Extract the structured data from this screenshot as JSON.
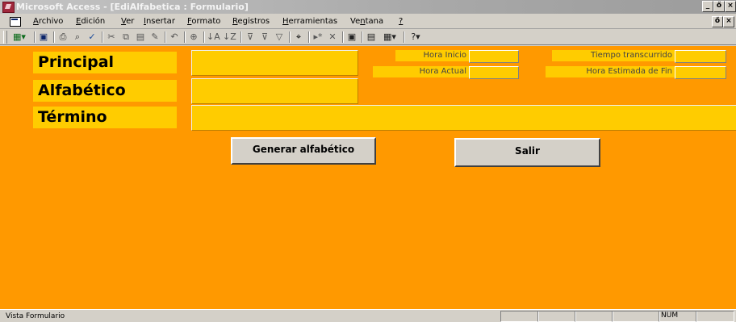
{
  "window": {
    "title": "Microsoft Access - [EdiAlfabetica : Formulario]",
    "controls": [
      "_",
      "ő",
      "×"
    ]
  },
  "menu": [
    {
      "key": "archivo",
      "prefix": "",
      "u": "A",
      "rest": "rchivo"
    },
    {
      "key": "edicion",
      "prefix": "",
      "u": "E",
      "rest": "dición"
    },
    {
      "key": "ver",
      "prefix": "",
      "u": "V",
      "rest": "er"
    },
    {
      "key": "insertar",
      "prefix": "",
      "u": "I",
      "rest": "nsertar"
    },
    {
      "key": "formato",
      "prefix": "",
      "u": "F",
      "rest": "ormato"
    },
    {
      "key": "registros",
      "prefix": "",
      "u": "R",
      "rest": "egistros"
    },
    {
      "key": "herramientas",
      "prefix": "",
      "u": "H",
      "rest": "erramientas"
    },
    {
      "key": "ventana",
      "prefix": "Ve",
      "u": "n",
      "rest": "tana"
    },
    {
      "key": "ayuda",
      "prefix": "",
      "u": "?",
      "rest": ""
    }
  ],
  "toolbar_icons": [
    "view-icon",
    "save-icon",
    "print-icon",
    "print-preview-icon",
    "spelling-icon",
    "cut-icon",
    "copy-icon",
    "paste-icon",
    "format-painter-icon",
    "undo-icon",
    "hyperlink-icon",
    "sort-ascending-icon",
    "sort-descending-icon",
    "filter-by-selection-icon",
    "filter-by-form-icon",
    "apply-filter-icon",
    "find-icon",
    "new-record-icon",
    "delete-record-icon",
    "properties-icon",
    "database-window-icon",
    "new-object-icon",
    "help-icon"
  ],
  "form": {
    "principal": {
      "label": "Principal",
      "value": ""
    },
    "alfabetico": {
      "label": "Alfabético",
      "value": ""
    },
    "termino": {
      "label": "Término",
      "value": ""
    },
    "hora_inicio": {
      "label": "Hora Inicio",
      "value": ""
    },
    "hora_actual": {
      "label": "Hora Actual",
      "value": ""
    },
    "tiempo_transcurrido": {
      "label": "Tiempo transcurrido",
      "value": ""
    },
    "hora_estimada_fin": {
      "label": "Hora Estimada de Fin",
      "value": ""
    },
    "generar_button": "Generar alfabético",
    "salir_button": "Salir"
  },
  "colors": {
    "form_background": "#ff9900",
    "field_background": "#ffcc00"
  },
  "statusbar": {
    "text": "Vista Formulario",
    "num": "NUM"
  }
}
